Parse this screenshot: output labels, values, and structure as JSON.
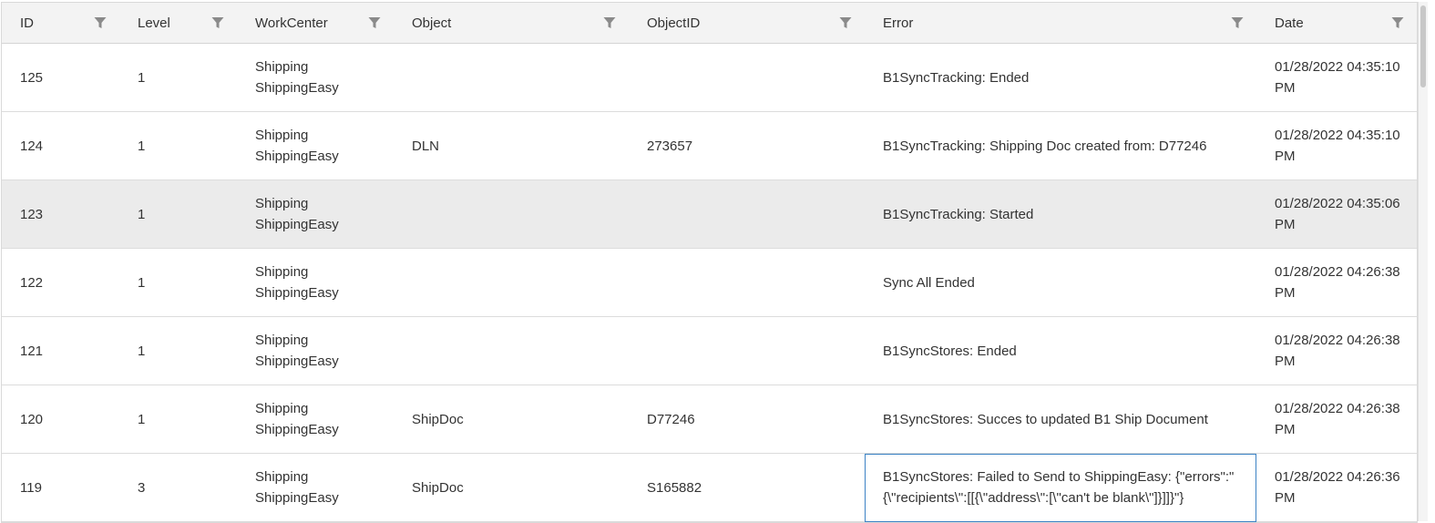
{
  "columns": [
    {
      "key": "id",
      "label": "ID"
    },
    {
      "key": "level",
      "label": "Level"
    },
    {
      "key": "workcenter",
      "label": "WorkCenter"
    },
    {
      "key": "object",
      "label": "Object"
    },
    {
      "key": "objectid",
      "label": "ObjectID"
    },
    {
      "key": "error",
      "label": "Error"
    },
    {
      "key": "date",
      "label": "Date"
    }
  ],
  "filter_icon": "filter-icon",
  "selected_row_id": "123",
  "focused_cell": {
    "row_id": "119",
    "column": "error"
  },
  "rows": [
    {
      "id": "125",
      "level": "1",
      "workcenter": [
        "Shipping",
        "ShippingEasy"
      ],
      "object": "",
      "objectid": "",
      "error": "B1SyncTracking: Ended",
      "date": [
        "01/28/2022 04:35:10",
        "PM"
      ]
    },
    {
      "id": "124",
      "level": "1",
      "workcenter": [
        "Shipping",
        "ShippingEasy"
      ],
      "object": "DLN",
      "objectid": "273657",
      "error": "B1SyncTracking: Shipping Doc created from: D77246",
      "date": [
        "01/28/2022 04:35:10",
        "PM"
      ]
    },
    {
      "id": "123",
      "level": "1",
      "workcenter": [
        "Shipping",
        "ShippingEasy"
      ],
      "object": "",
      "objectid": "",
      "error": "B1SyncTracking: Started",
      "date": [
        "01/28/2022 04:35:06",
        "PM"
      ]
    },
    {
      "id": "122",
      "level": "1",
      "workcenter": [
        "Shipping",
        "ShippingEasy"
      ],
      "object": "",
      "objectid": "",
      "error": "Sync All Ended",
      "date": [
        "01/28/2022 04:26:38",
        "PM"
      ]
    },
    {
      "id": "121",
      "level": "1",
      "workcenter": [
        "Shipping",
        "ShippingEasy"
      ],
      "object": "",
      "objectid": "",
      "error": "B1SyncStores: Ended",
      "date": [
        "01/28/2022 04:26:38",
        "PM"
      ]
    },
    {
      "id": "120",
      "level": "1",
      "workcenter": [
        "Shipping",
        "ShippingEasy"
      ],
      "object": "ShipDoc",
      "objectid": "D77246",
      "error": "B1SyncStores: Succes to updated B1 Ship Document",
      "date": [
        "01/28/2022 04:26:38",
        "PM"
      ]
    },
    {
      "id": "119",
      "level": "3",
      "workcenter": [
        "Shipping",
        "ShippingEasy"
      ],
      "object": "ShipDoc",
      "objectid": "S165882",
      "error": "B1SyncStores: Failed to Send to ShippingEasy: {\"errors\":\"{\\\"recipients\\\":[[{\\\"address\\\":[\\\"can't be blank\\\"]}]]}\"}",
      "date": [
        "01/28/2022 04:26:36",
        "PM"
      ]
    }
  ]
}
